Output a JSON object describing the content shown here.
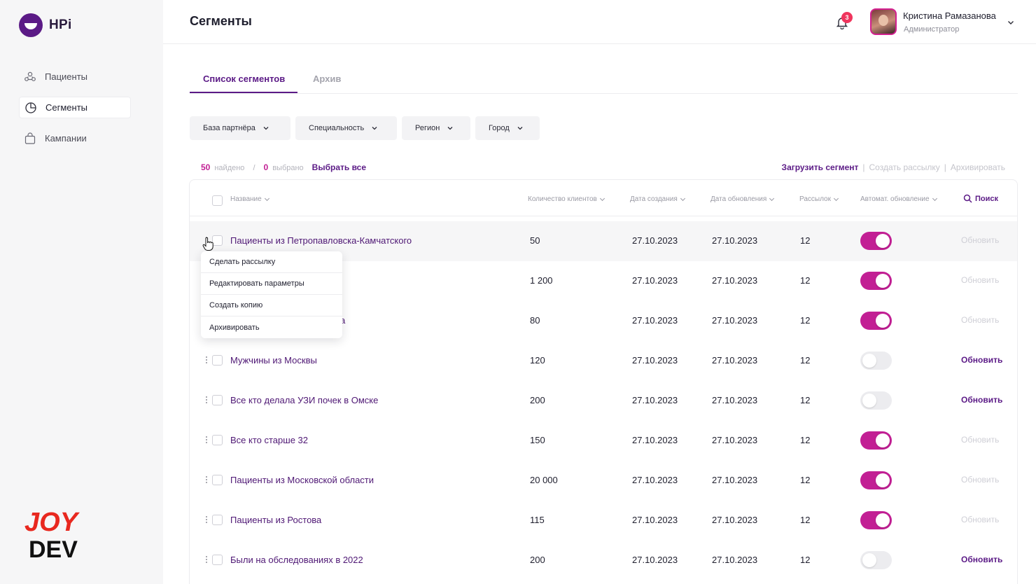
{
  "app": {
    "logo_text": "HPi",
    "brand_watermark_top": "JOY",
    "brand_watermark_bottom": "DEV"
  },
  "sidebar": {
    "items": [
      {
        "label": "Пациенты",
        "icon": "patients-icon",
        "active": false
      },
      {
        "label": "Сегменты",
        "icon": "pie-chart-icon",
        "active": true
      },
      {
        "label": "Кампании",
        "icon": "bag-icon",
        "active": false
      }
    ]
  },
  "header": {
    "title": "Сегменты",
    "notifications_count": "3",
    "user_name": "Кристина Рамазанова",
    "user_role": "Администратор"
  },
  "tabs": [
    {
      "label": "Список сегментов",
      "active": true
    },
    {
      "label": "Архив",
      "active": false
    }
  ],
  "filters": [
    "База партнёра",
    "Специальность",
    "Регион",
    "Город"
  ],
  "counters": {
    "found": "50",
    "found_label": "найдено",
    "separator": "/",
    "selected": "0",
    "selected_label": "выбрано",
    "select_all": "Выбрать все"
  },
  "actions": {
    "upload": "Загрузить сегмент",
    "separator": "|",
    "create_mailing": "Создать рассылку",
    "archive": "Архивировать"
  },
  "table": {
    "columns": {
      "name": "Название",
      "clients": "Количество клиентов",
      "created": "Дата создания",
      "updated": "Дата обновления",
      "mailings": "Рассылок",
      "auto_update": "Автомат. обновление",
      "search": "Поиск"
    },
    "refresh_label": "Обновить",
    "rows": [
      {
        "name": "Пациенты из Петропавловска-Камчатского",
        "clients": "50",
        "created": "27.10.2023",
        "updated": "27.10.2023",
        "mailings": "12",
        "auto": true
      },
      {
        "name": "",
        "clients": "1 200",
        "created": "27.10.2023",
        "updated": "27.10.2023",
        "mailings": "12",
        "auto": true
      },
      {
        "name": "а",
        "clients": "80",
        "created": "27.10.2023",
        "updated": "27.10.2023",
        "mailings": "12",
        "auto": true
      },
      {
        "name": "Мужчины из Москвы",
        "clients": "120",
        "created": "27.10.2023",
        "updated": "27.10.2023",
        "mailings": "12",
        "auto": false
      },
      {
        "name": "Все кто делала УЗИ почек в Омске",
        "clients": "200",
        "created": "27.10.2023",
        "updated": "27.10.2023",
        "mailings": "12",
        "auto": false
      },
      {
        "name": "Все кто старше 32",
        "clients": "150",
        "created": "27.10.2023",
        "updated": "27.10.2023",
        "mailings": "12",
        "auto": true
      },
      {
        "name": "Пациенты из Московской области",
        "clients": "20 000",
        "created": "27.10.2023",
        "updated": "27.10.2023",
        "mailings": "12",
        "auto": true
      },
      {
        "name": "Пациенты из Ростова",
        "clients": "115",
        "created": "27.10.2023",
        "updated": "27.10.2023",
        "mailings": "12",
        "auto": true
      },
      {
        "name": "Были на обследованиях в 2022",
        "clients": "200",
        "created": "27.10.2023",
        "updated": "27.10.2023",
        "mailings": "12",
        "auto": false
      }
    ]
  },
  "context_menu": [
    "Сделать рассылку",
    "Редактировать параметры",
    "Создать копию",
    "Архивировать"
  ],
  "colors": {
    "primary": "#5b1a86",
    "accent": "#c21f94",
    "badge": "#f0355d"
  }
}
